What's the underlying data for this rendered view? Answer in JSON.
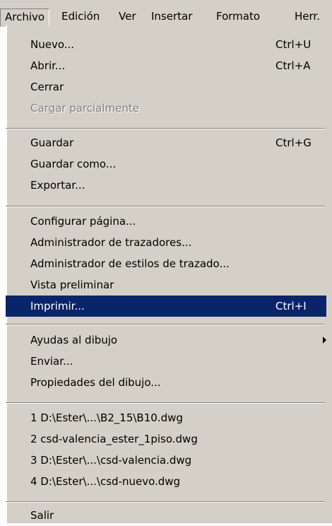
{
  "menubar": {
    "items": [
      "Archivo",
      "Edición",
      "Ver",
      "Insertar",
      "Formato",
      "Herr."
    ]
  },
  "menu": {
    "nuevo": {
      "label": "Nuevo...",
      "shortcut": "Ctrl+U"
    },
    "abrir": {
      "label": "Abrir...",
      "shortcut": "Ctrl+A"
    },
    "cerrar": {
      "label": "Cerrar"
    },
    "cargar": {
      "label": "Cargar parcialmente"
    },
    "guardar": {
      "label": "Guardar",
      "shortcut": "Ctrl+G"
    },
    "guardar_como": {
      "label": "Guardar como..."
    },
    "exportar": {
      "label": "Exportar..."
    },
    "configurar": {
      "label": "Configurar página..."
    },
    "admin_trazadores": {
      "label": "Administrador de trazadores..."
    },
    "admin_estilos": {
      "label": "Administrador de estilos de trazado..."
    },
    "vista": {
      "label": "Vista preliminar"
    },
    "imprimir": {
      "label": "Imprimir...",
      "shortcut": "Ctrl+I"
    },
    "ayudas": {
      "label": "Ayudas al dibujo"
    },
    "enviar": {
      "label": "Enviar..."
    },
    "propiedades": {
      "label": "Propiedades del dibujo..."
    },
    "recent": [
      "1 D:\\Ester\\...\\B2_15\\B10.dwg",
      "2 csd-valencia_ester_1piso.dwg",
      "3 D:\\Ester\\...\\csd-valencia.dwg",
      "4 D:\\Ester\\...\\csd-nuevo.dwg"
    ],
    "salir": {
      "label": "Salir"
    }
  },
  "colors": {
    "menu_bg": "#d4d0c8",
    "highlight_bg": "#0a246a",
    "highlight_text": "#ffffff",
    "disabled_text": "#808080"
  }
}
